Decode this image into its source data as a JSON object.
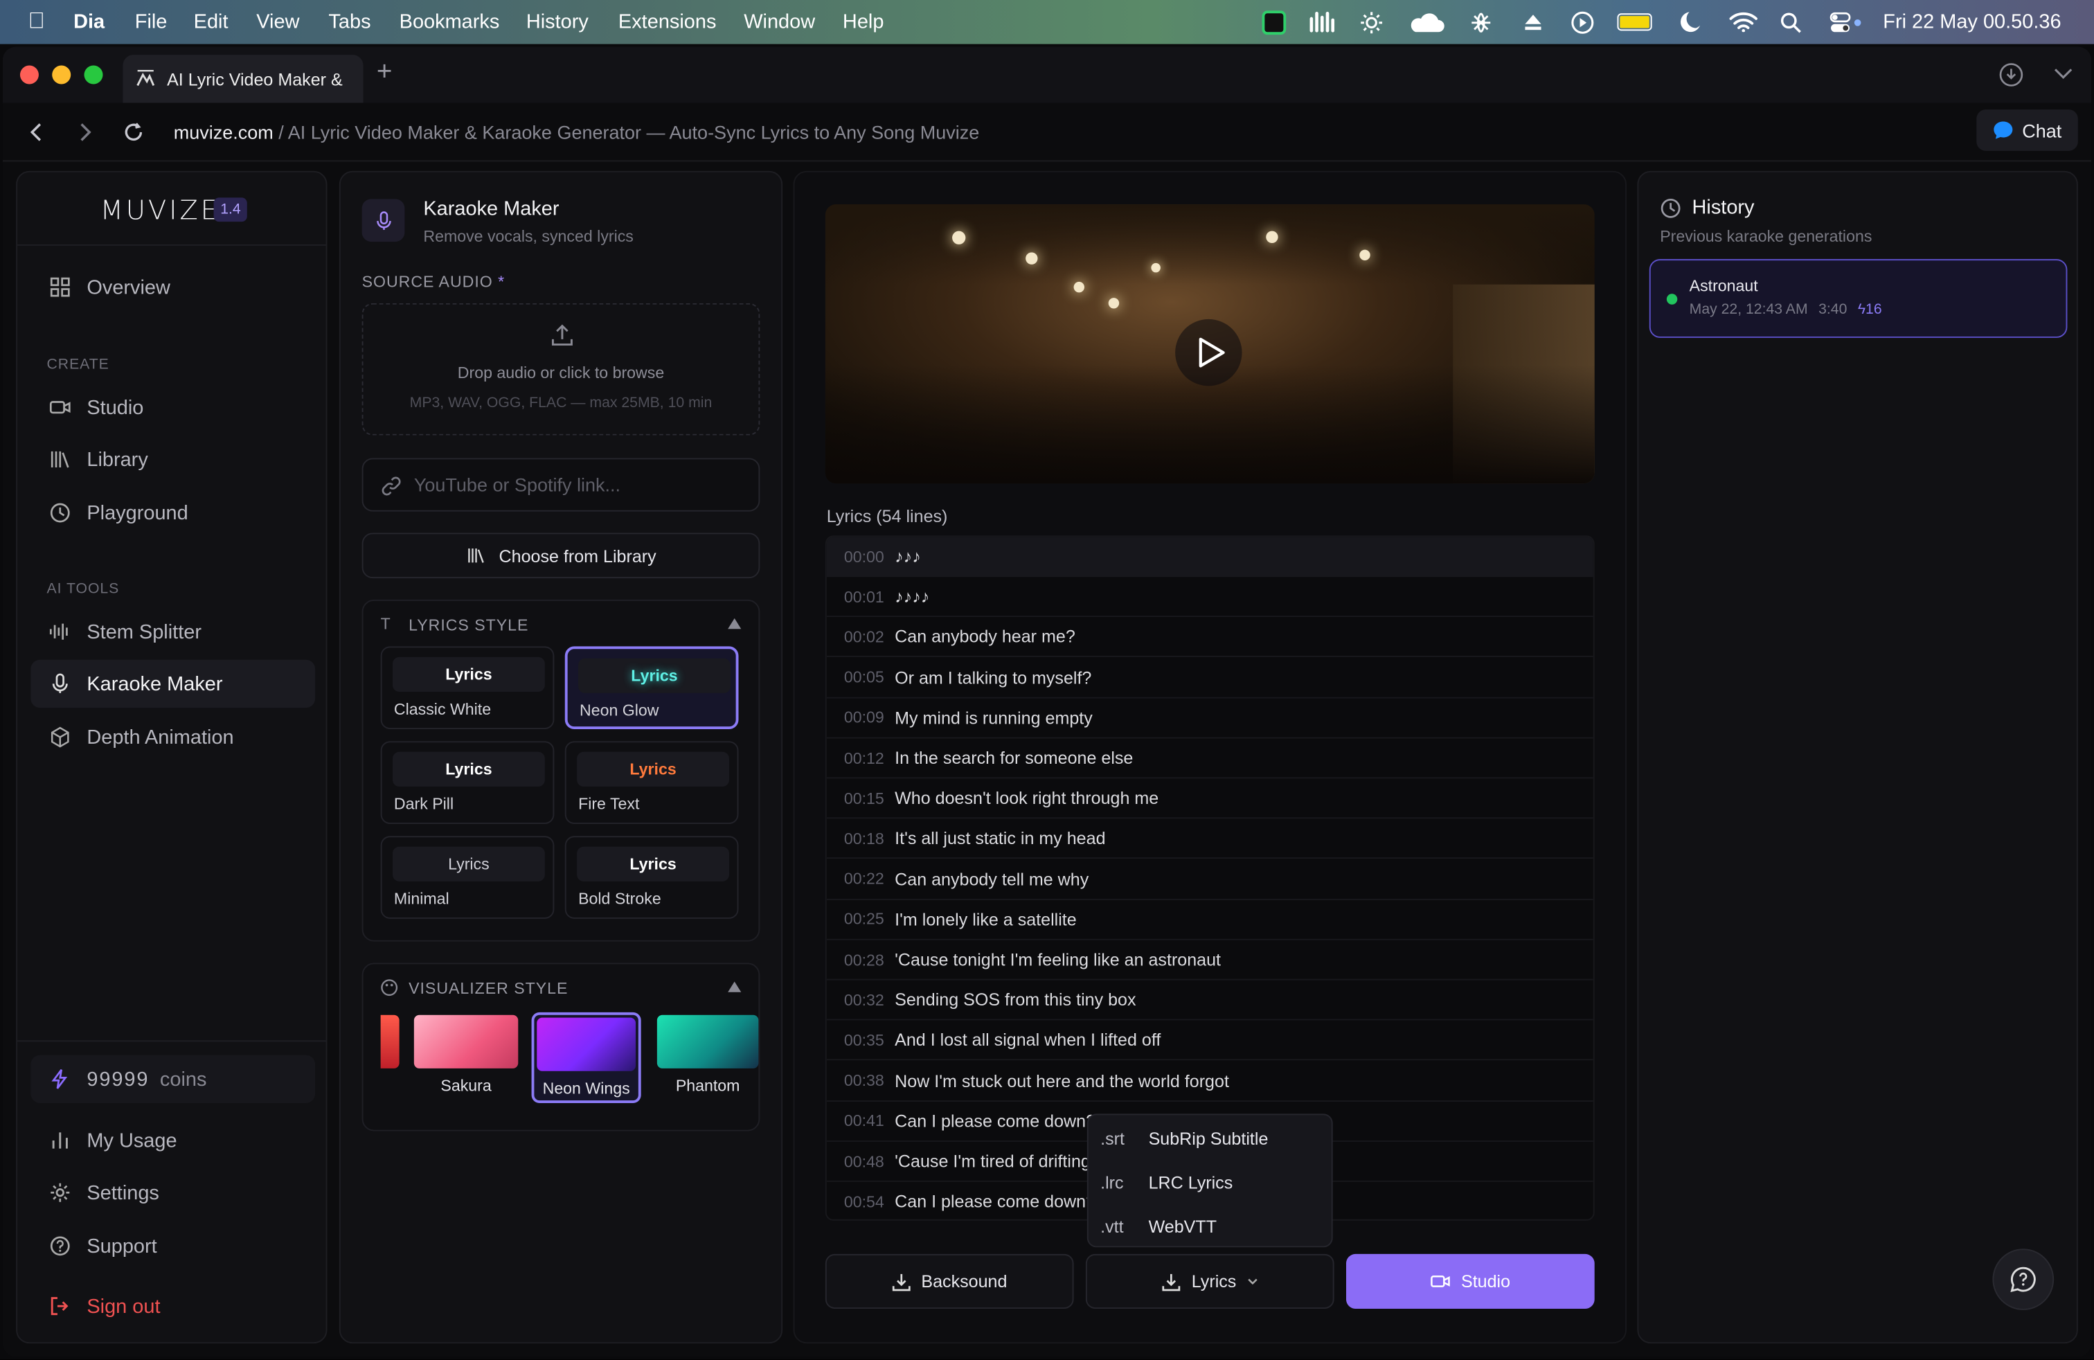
{
  "menubar": {
    "app": "Dia",
    "items": [
      "File",
      "Edit",
      "View",
      "Tabs",
      "Bookmarks",
      "History",
      "Extensions",
      "Window",
      "Help"
    ],
    "clock": "Fri 22 May  00.50.36"
  },
  "tab": {
    "title": "AI Lyric Video Maker &"
  },
  "address": {
    "domain": "muvize.com",
    "path": " / AI Lyric Video Maker & Karaoke Generator — Auto-Sync Lyrics to Any Song Muvize",
    "chat": "Chat"
  },
  "sidebar": {
    "logo": "MUVIZE",
    "version": "1.4",
    "overview": "Overview",
    "create_label": "CREATE",
    "studio": "Studio",
    "library": "Library",
    "playground": "Playground",
    "aitools_label": "AI TOOLS",
    "stem": "Stem Splitter",
    "karaoke": "Karaoke Maker",
    "depth": "Depth Animation",
    "coins_value": "99999",
    "coins_unit": "coins",
    "usage": "My Usage",
    "settings": "Settings",
    "support": "Support",
    "signout": "Sign out"
  },
  "tool": {
    "title": "Karaoke Maker",
    "subtitle": "Remove vocals, synced lyrics",
    "source_label": "SOURCE AUDIO",
    "required": "*",
    "drop_text": "Drop audio or click to browse",
    "drop_hint": "MP3, WAV, OGG, FLAC — max 25MB, 10 min",
    "link_placeholder": "YouTube or Spotify link...",
    "library_btn": "Choose from Library",
    "lyrics_style_label": "LYRICS STYLE",
    "visualizer_label": "VISUALIZER STYLE"
  },
  "lyrics_styles": [
    {
      "preview": "Lyrics",
      "name": "Classic White",
      "color": "#ffffff"
    },
    {
      "preview": "Lyrics",
      "name": "Neon Glow",
      "color": "#5ff0e6"
    },
    {
      "preview": "Lyrics",
      "name": "Dark Pill",
      "color": "#ffffff"
    },
    {
      "preview": "Lyrics",
      "name": "Fire Text",
      "color": "#ff7a3c"
    },
    {
      "preview": "Lyrics",
      "name": "Minimal",
      "color": "#d0d0d8"
    },
    {
      "preview": "Lyrics",
      "name": "Bold Stroke",
      "color": "#ffffff"
    }
  ],
  "visualizers": [
    "Sakura",
    "Neon Wings",
    "Phantom"
  ],
  "lyrics": {
    "header": "Lyrics (54 lines)",
    "lines": [
      {
        "t": "00:00",
        "text": "♪♪♪"
      },
      {
        "t": "00:01",
        "text": "♪♪♪♪"
      },
      {
        "t": "00:02",
        "text": "Can anybody hear me?"
      },
      {
        "t": "00:05",
        "text": "Or am I talking to myself?"
      },
      {
        "t": "00:09",
        "text": "My mind is running empty"
      },
      {
        "t": "00:12",
        "text": "In the search for someone else"
      },
      {
        "t": "00:15",
        "text": "Who doesn't look right through me"
      },
      {
        "t": "00:18",
        "text": "It's all just static in my head"
      },
      {
        "t": "00:22",
        "text": "Can anybody tell me why"
      },
      {
        "t": "00:25",
        "text": "I'm lonely like a satellite"
      },
      {
        "t": "00:28",
        "text": "'Cause tonight I'm feeling like an astronaut"
      },
      {
        "t": "00:32",
        "text": "Sending SOS from this tiny box"
      },
      {
        "t": "00:35",
        "text": "And I lost all signal when I lifted off"
      },
      {
        "t": "00:38",
        "text": "Now I'm stuck out here and the world forgot"
      },
      {
        "t": "00:41",
        "text": "Can I please come down?"
      },
      {
        "t": "00:48",
        "text": "'Cause I'm tired of drifting"
      },
      {
        "t": "00:54",
        "text": "Can I please come down?"
      }
    ]
  },
  "export_menu": [
    {
      "ext": ".srt",
      "label": "SubRip Subtitle"
    },
    {
      "ext": ".lrc",
      "label": "LRC Lyrics"
    },
    {
      "ext": ".vtt",
      "label": "WebVTT"
    }
  ],
  "actions": {
    "backsound": "Backsound",
    "lyrics": "Lyrics",
    "studio": "Studio"
  },
  "history": {
    "title": "History",
    "subtitle": "Previous karaoke generations",
    "item_title": "Astronaut",
    "item_date": "May 22, 12:43 AM",
    "item_duration": "3:40",
    "item_count": "16"
  },
  "colors": {
    "accent": "#8b5cf6",
    "status_green": "#22c55e"
  }
}
